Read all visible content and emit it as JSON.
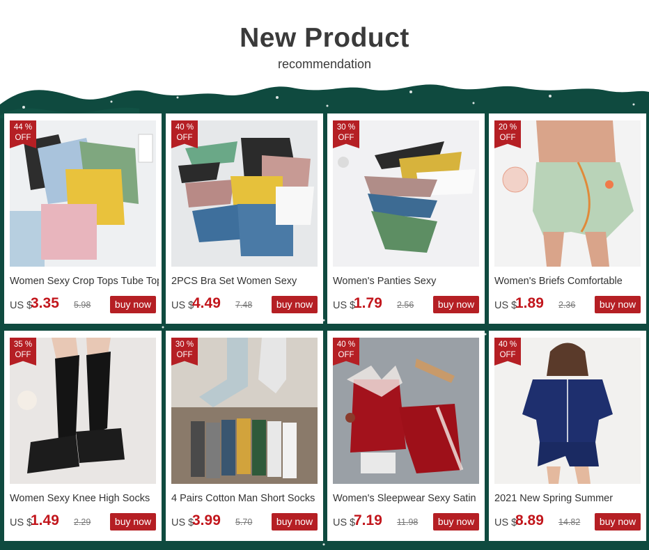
{
  "header": {
    "title": "New Product",
    "subtitle": "recommendation"
  },
  "colors": {
    "band_green": "#0f4a3f",
    "accent_red": "#b51f24",
    "price_red": "#c2161c"
  },
  "buy_label": "buy now",
  "currency_label": "US $",
  "products": [
    {
      "discount_pct": "44 %",
      "discount_off": "OFF",
      "name": "Women Sexy Crop Tops Tube Top",
      "price": "3.35",
      "old_price": "5.98",
      "image": "crop-tops-image"
    },
    {
      "discount_pct": "40 %",
      "discount_off": "OFF",
      "name": "2PCS Bra Set Women Sexy",
      "price": "4.49",
      "old_price": "7.48",
      "image": "bra-set-image"
    },
    {
      "discount_pct": "30 %",
      "discount_off": "OFF",
      "name": "Women's Panties Sexy",
      "price": "1.79",
      "old_price": "2.56",
      "image": "panties-image"
    },
    {
      "discount_pct": "20 %",
      "discount_off": "OFF",
      "name": "Women's Briefs Comfortable",
      "price": "1.89",
      "old_price": "2.36",
      "image": "briefs-image"
    },
    {
      "discount_pct": "35 %",
      "discount_off": "OFF",
      "name": "Women Sexy Knee High Socks",
      "price": "1.49",
      "old_price": "2.29",
      "image": "knee-socks-image"
    },
    {
      "discount_pct": "30 %",
      "discount_off": "OFF",
      "name": "4 Pairs Cotton Man Short Socks",
      "price": "3.99",
      "old_price": "5.70",
      "image": "short-socks-image"
    },
    {
      "discount_pct": "40 %",
      "discount_off": "OFF",
      "name": "Women's Sleepwear Sexy Satin",
      "price": "7.19",
      "old_price": "11.98",
      "image": "sleepwear-image"
    },
    {
      "discount_pct": "40 %",
      "discount_off": "OFF",
      "name": "2021 New Spring Summer",
      "price": "8.89",
      "old_price": "14.82",
      "image": "pajama-set-image"
    }
  ]
}
